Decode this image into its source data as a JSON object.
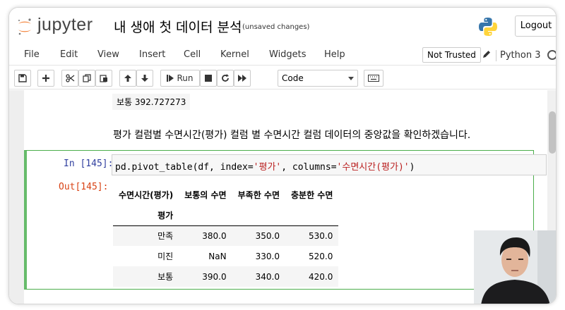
{
  "header": {
    "brand": "jupyter",
    "notebook_title": "내 생애 첫 데이터 분석",
    "save_status": "(unsaved changes)",
    "logout_label": "Logout"
  },
  "menubar": {
    "items": [
      "File",
      "Edit",
      "View",
      "Insert",
      "Cell",
      "Kernel",
      "Widgets",
      "Help"
    ],
    "trust_label": "Not Trusted",
    "kernel_name": "Python 3"
  },
  "toolbar": {
    "run_label": "Run",
    "cell_type": "Code"
  },
  "notebook": {
    "previous_output": "보통   392.727273",
    "markdown_text": "평가 컬럼별 수면시간(평가) 컬럼 별 수면시간 컬럼 데이터의 중앙값을 확인하겠습니다.",
    "cell": {
      "in_prompt": "In [145]:",
      "code_prefix": "pd.pivot_table(df, index=",
      "code_str1": "'평가'",
      "code_mid": ", columns=",
      "code_str2": "'수면시간(평가)'",
      "code_suffix": ")",
      "out_prompt": "Out[145]:"
    },
    "table": {
      "columns_name": "수면시간(평가)",
      "columns": [
        "보통의 수면",
        "부족한 수면",
        "충분한 수면"
      ],
      "index_name": "평가",
      "rows": [
        {
          "index": "만족",
          "values": [
            "380.0",
            "350.0",
            "530.0"
          ]
        },
        {
          "index": "미진",
          "values": [
            "NaN",
            "330.0",
            "520.0"
          ]
        },
        {
          "index": "보통",
          "values": [
            "390.0",
            "340.0",
            "420.0"
          ]
        }
      ]
    }
  },
  "colors": {
    "cell_border": "#4cae4c",
    "in_prompt": "#303f9f",
    "out_prompt": "#d84315",
    "jupyter_orange": "#f37726"
  }
}
